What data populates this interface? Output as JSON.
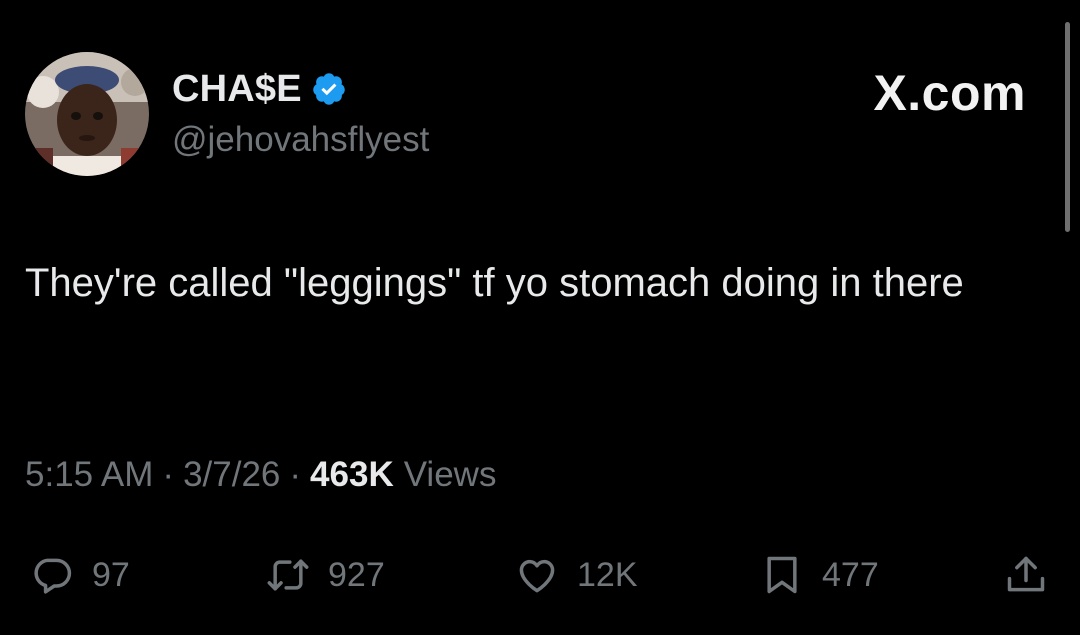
{
  "author": {
    "display_name": "CHA$E",
    "handle": "@jehovahsflyest",
    "verified": true
  },
  "site_mark": "X.com",
  "tweet": {
    "text": "They're called \"leggings\" tf yo stomach doing in there"
  },
  "meta": {
    "time": "5:15 AM",
    "separator": "·",
    "date": "3/7/26",
    "views_count": "463K",
    "views_label": "Views"
  },
  "actions": {
    "replies": "97",
    "reposts": "927",
    "likes": "12K",
    "bookmarks": "477"
  },
  "colors": {
    "background": "#000000",
    "primary_text": "#e7e9ea",
    "secondary_text": "#71767b",
    "verified_badge": "#1d9bf0"
  },
  "icons": {
    "verified": "verified-badge-icon",
    "reply": "reply-icon",
    "repost": "repost-icon",
    "like": "heart-icon",
    "bookmark": "bookmark-icon",
    "share": "share-icon"
  }
}
